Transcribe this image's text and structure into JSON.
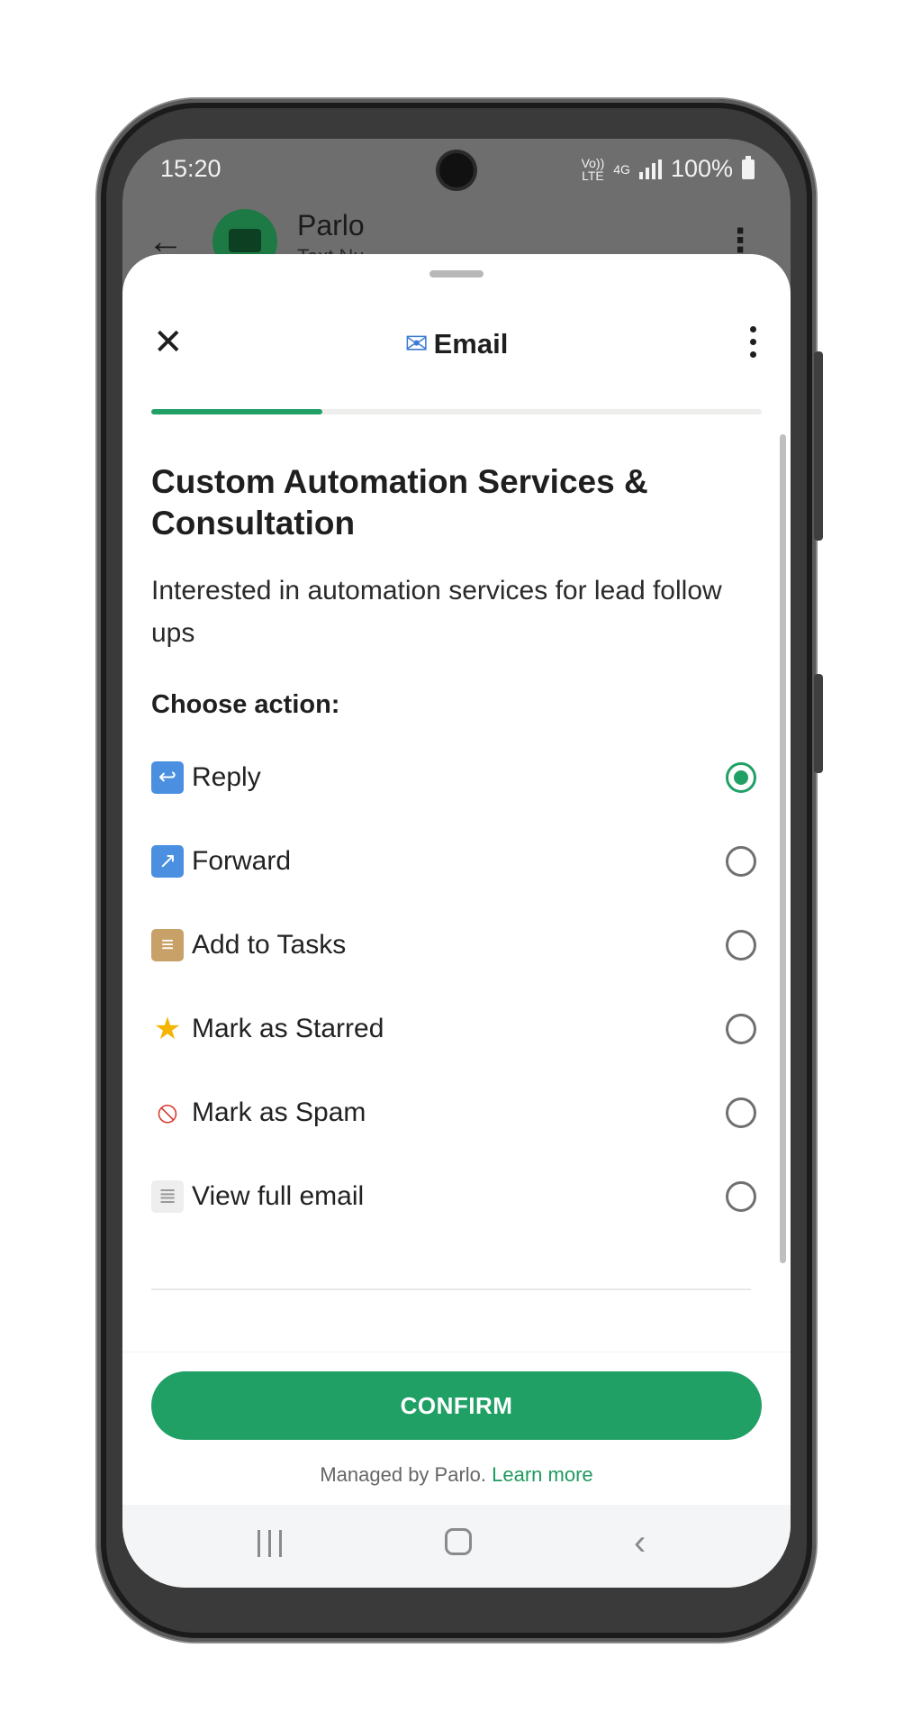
{
  "status_bar": {
    "time": "15:20",
    "battery": "100%",
    "net_small_top": "Vo))",
    "net_small_bottom": "LTE",
    "gen": "4G"
  },
  "background_app": {
    "contact_name": "Parlo",
    "contact_sub": "Text Nu..."
  },
  "sheet": {
    "title": "Email",
    "title_icon": "mailbox-icon",
    "progress": 0.28,
    "heading": "Custom Automation Services & Consultation",
    "description": "Interested in automation services for lead follow ups",
    "choose_label": "Choose action:",
    "options": [
      {
        "label": "Reply",
        "icon": "reply-icon",
        "selected": true
      },
      {
        "label": "Forward",
        "icon": "forward-icon",
        "selected": false
      },
      {
        "label": "Add to Tasks",
        "icon": "clipboard-icon",
        "selected": false
      },
      {
        "label": "Mark as Starred",
        "icon": "star-icon",
        "selected": false
      },
      {
        "label": "Mark as Spam",
        "icon": "prohibited-icon",
        "selected": false
      },
      {
        "label": "View full email",
        "icon": "document-icon",
        "selected": false
      }
    ],
    "confirm_label": "CONFIRM",
    "managed_text": "Managed by Parlo.",
    "learn_more": "Learn more"
  },
  "colors": {
    "accent": "#21a066",
    "link": "#1f9a5f"
  }
}
